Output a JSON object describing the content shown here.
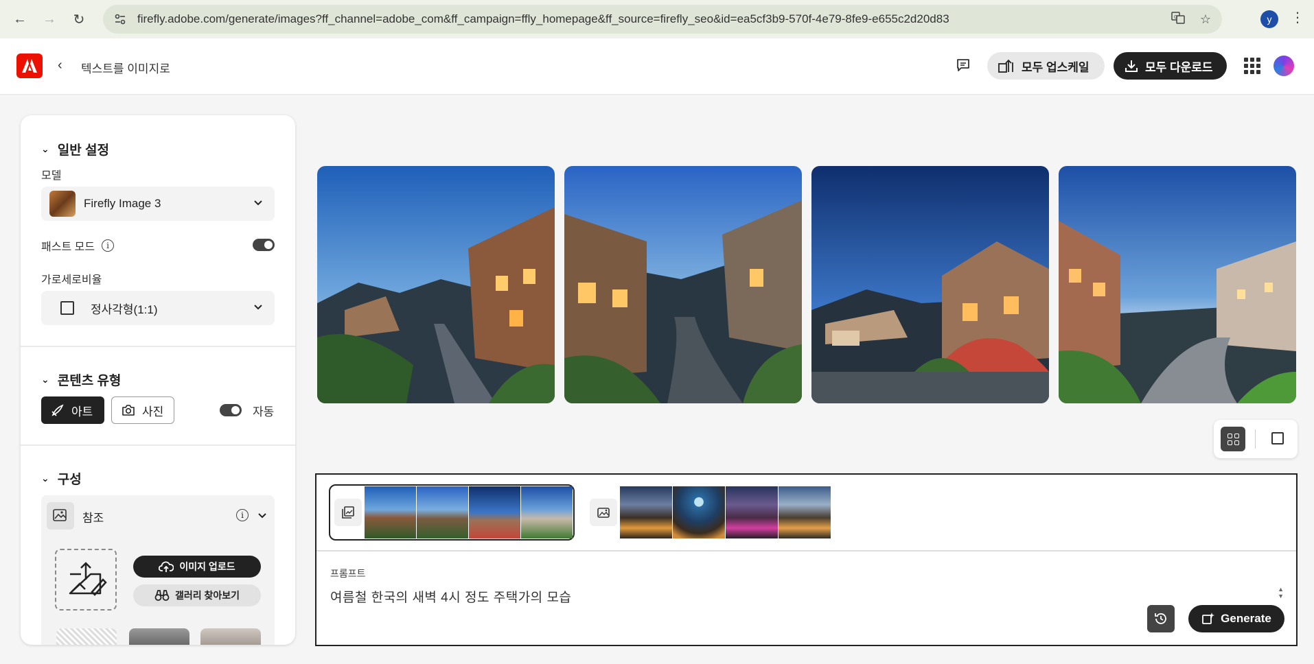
{
  "browser": {
    "url": "firefly.adobe.com/generate/images?ff_channel=adobe_com&ff_campaign=ffly_homepage&ff_source=firefly_seo&id=ea5cf3b9-570f-4e79-8fe9-e655c2d20d83",
    "profile_initial": "y"
  },
  "header": {
    "title": "텍스트를 이미지로",
    "upscale_all": "모두 업스케일",
    "download_all": "모두 다운로드"
  },
  "panel": {
    "general": {
      "title": "일반 설정",
      "model_label": "모델",
      "model_value": "Firefly Image 3",
      "fast_mode_label": "패스트 모드",
      "aspect_label": "가로세로비율",
      "aspect_value": "정사각형(1:1)"
    },
    "content_type": {
      "title": "콘텐츠 유형",
      "art": "아트",
      "photo": "사진",
      "auto": "자동"
    },
    "composition": {
      "title": "구성",
      "reference": "참조",
      "upload_image": "이미지 업로드",
      "browse_gallery": "갤러리 찾아보기"
    }
  },
  "prompt": {
    "label": "프롬프트",
    "text": "여름철 한국의 새벽 4시 정도 주택가의 모습",
    "generate": "Generate"
  },
  "colors": {
    "adobe_red": "#eb1000",
    "dark": "#222222"
  }
}
